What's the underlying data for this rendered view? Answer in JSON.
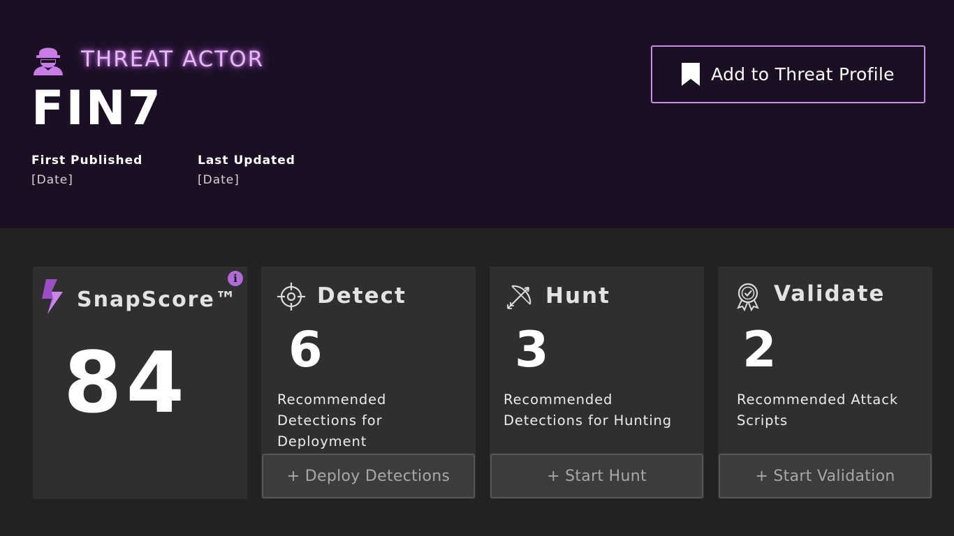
{
  "header": {
    "entity_type": "THREAT ACTOR",
    "actor_name": "FIN7",
    "first_published_label": "First Published",
    "first_published_value": "[Date]",
    "last_updated_label": "Last Updated",
    "last_updated_value": "[Date]",
    "add_button_label": "Add to Threat Profile",
    "icons": {
      "actor": "hacker-icon",
      "add": "bookmark-icon"
    }
  },
  "cards": {
    "snapscore": {
      "title": "SnapScore™",
      "score": "84",
      "info_glyph": "i",
      "icon": "lightning-bolt-icon"
    },
    "detect": {
      "title": "Detect",
      "count": "6",
      "description": "Recommended Detections for Deployment",
      "button": "+ Deploy Detections",
      "icon": "crosshair-icon"
    },
    "hunt": {
      "title": "Hunt",
      "count": "3",
      "description": "Recommended Detections for Hunting",
      "button": "+ Start Hunt",
      "icon": "bow-arrow-icon"
    },
    "validate": {
      "title": "Validate",
      "count": "2",
      "description": "Recommended Attack Scripts",
      "button": "+ Start Validation",
      "icon": "award-badge-icon"
    }
  },
  "colors": {
    "hero_background": "#1b0f24",
    "page_background": "#222222",
    "card_background": "#2f2f2f",
    "accent_purple": "#c690e6",
    "glow_text": "#e6b9f5",
    "button_background": "#3c3c3c",
    "button_text": "#a8a8a8"
  }
}
